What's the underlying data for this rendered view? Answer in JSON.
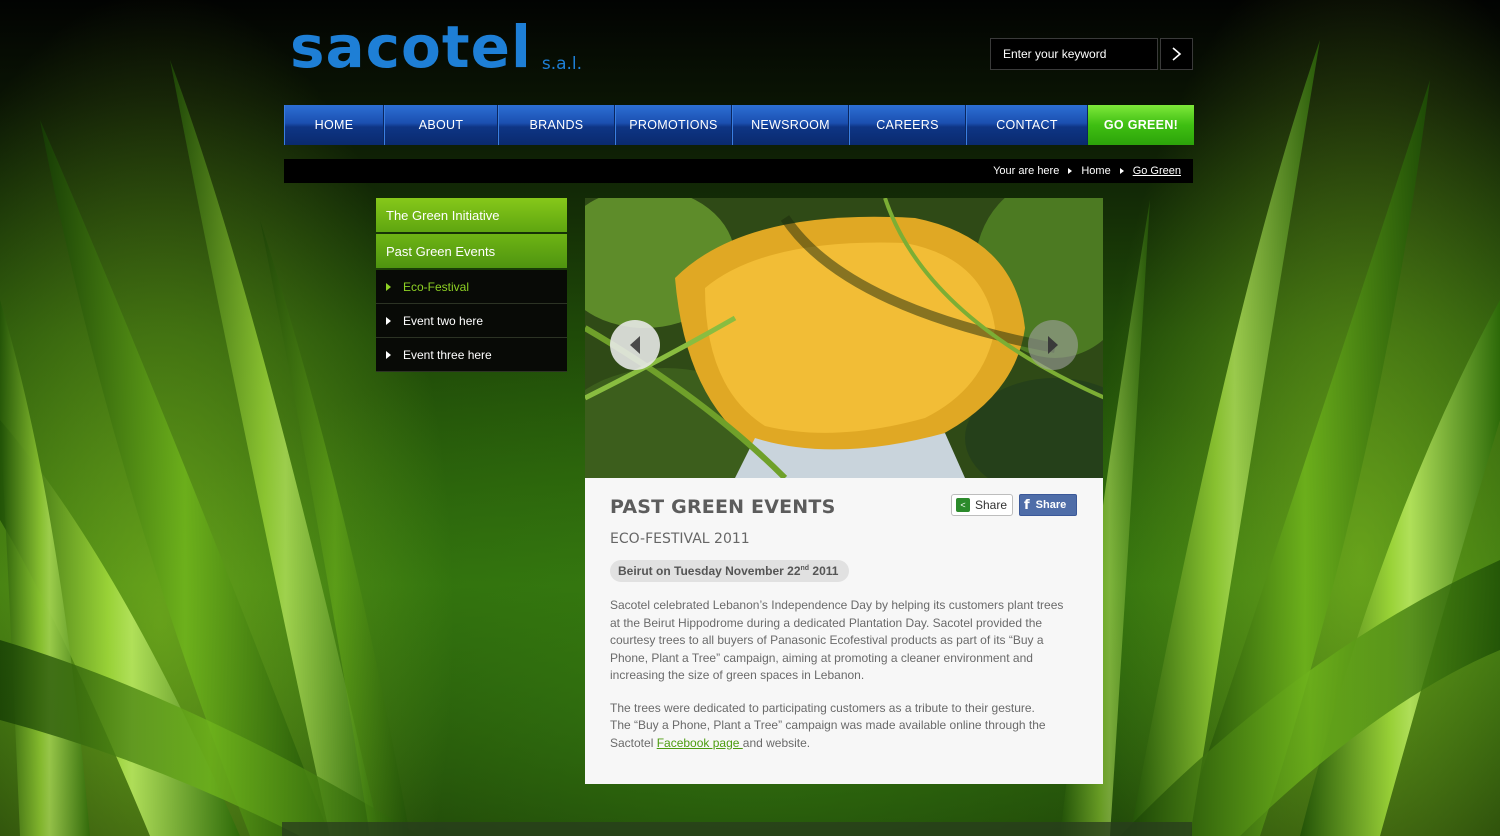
{
  "brand": {
    "name": "sacotel",
    "suffix": "s.a.l.",
    "color": "#1e7fd6"
  },
  "search": {
    "placeholder": "Enter your keyword",
    "button_icon": "chevron-right-icon"
  },
  "nav": {
    "items": [
      {
        "label": "HOME"
      },
      {
        "label": "ABOUT"
      },
      {
        "label": "BRANDS"
      },
      {
        "label": "PROMOTIONS"
      },
      {
        "label": "NEWSROOM"
      },
      {
        "label": "CAREERS"
      },
      {
        "label": "CONTACT"
      },
      {
        "label": "GO GREEN!"
      }
    ],
    "accent": "#1b4fb0",
    "go_green_color": "#3fbf12"
  },
  "breadcrumb": {
    "prefix": "Your are here",
    "items": [
      "Home",
      "Go Green"
    ]
  },
  "sidebar": {
    "sections": [
      {
        "label": "The Green Initiative"
      },
      {
        "label": "Past Green Events"
      }
    ],
    "events": [
      {
        "label": "Eco-Festival",
        "selected": true
      },
      {
        "label": "Event two here",
        "selected": false
      },
      {
        "label": "Event three here",
        "selected": false
      }
    ],
    "selected_color": "#8ed124"
  },
  "slider": {
    "prev_icon": "chevron-left-icon",
    "next_icon": "chevron-right-icon"
  },
  "article": {
    "title": "PAST GREEN EVENTS",
    "subtitle": "ECO-FESTIVAL 2011",
    "date_prefix": "Beirut on Tuesday November 22",
    "date_sup": "nd",
    "date_suffix": " 2011",
    "paragraph1": "Sacotel celebrated Lebanon’s Independence Day by helping its customers plant trees at the Beirut Hippodrome during a dedicated Plantation Day. Sacotel provided the courtesy trees to all buyers of Panasonic Ecofestival products as part of its “Buy a Phone, Plant a Tree” campaign, aiming at promoting a cleaner environment and increasing the size of green spaces in Lebanon.",
    "paragraph2_line1": "The trees were dedicated to participating customers as a tribute to their gesture.",
    "paragraph2_line2_start": "The “Buy a Phone, Plant a Tree” campaign was made available online through the Sactotel ",
    "paragraph2_link": "Facebook page ",
    "paragraph2_end": "and website.",
    "share_label": "Share",
    "fb_share_label": "Share",
    "fb_icon_letter": "f"
  }
}
